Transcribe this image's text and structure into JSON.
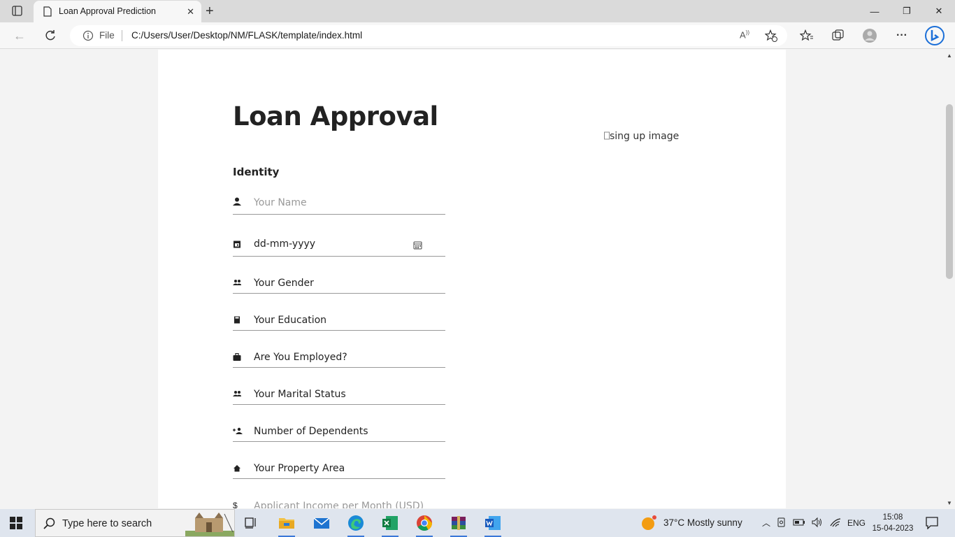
{
  "browser": {
    "tab_title": "Loan Approval Prediction",
    "address_scheme": "File",
    "url": "C:/Users/User/Desktop/NM/FLASK/template/index.html"
  },
  "form": {
    "title": "Loan Approval",
    "subtitle": "Identity",
    "name_placeholder": "Your Name",
    "date_placeholder": "dd-mm-yyyy",
    "gender": "Your Gender",
    "education": "Your Education",
    "employed": "Are You Employed?",
    "marital": "Your Marital Status",
    "dependents": "Number of Dependents",
    "property": "Your Property Area",
    "income_placeholder": "Applicant Income per Month (USD)"
  },
  "image_alt": "sing up image",
  "taskbar": {
    "search_placeholder": "Type here to search",
    "weather": "37°C  Mostly sunny",
    "language": "ENG",
    "time": "15:08",
    "date": "15-04-2023"
  }
}
